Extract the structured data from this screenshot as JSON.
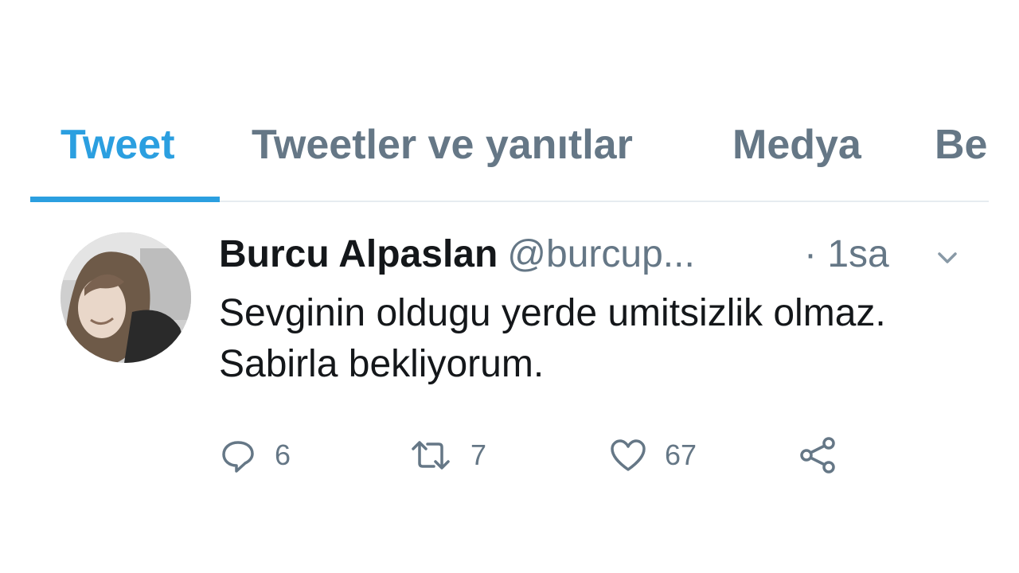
{
  "tabs": [
    {
      "label": "Tweet",
      "active": true
    },
    {
      "label": "Tweetler ve yanıtlar",
      "active": false
    },
    {
      "label": "Medya",
      "active": false
    },
    {
      "label": "Be",
      "active": false
    }
  ],
  "tweet": {
    "display_name": "Burcu Alpaslan",
    "handle": "@burcup...",
    "time": "· 1sa",
    "text": "Sevginin oldugu yerde umitsizlik olmaz. Sabirla bekliyorum.",
    "replies": "6",
    "retweets": "7",
    "likes": "67"
  },
  "icons": {
    "reply": "speech-bubble-icon",
    "retweet": "retweet-arrows-icon",
    "like": "heart-icon",
    "share": "share-icon",
    "caret": "chevron-down-icon"
  },
  "colors": {
    "accent": "#2b9fe0",
    "muted": "#657786",
    "text": "#14171a",
    "divider": "#e6ecf0"
  }
}
